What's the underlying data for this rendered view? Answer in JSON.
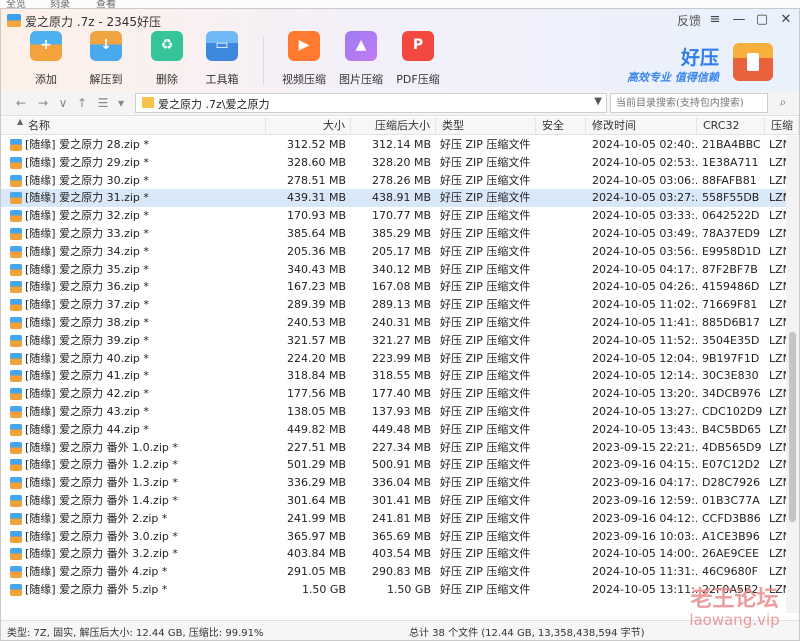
{
  "menubar": {
    "items": [
      "全览",
      "刻录",
      "查看"
    ]
  },
  "window": {
    "title": "爱之原力 .7z - 2345好压",
    "feedback": "反馈",
    "controls": [
      "≡",
      "—",
      "▢",
      "✕"
    ]
  },
  "toolbar": [
    {
      "label": "添加",
      "icon": "add-archive-icon"
    },
    {
      "label": "解压到",
      "icon": "extract-icon"
    },
    {
      "label": "删除",
      "icon": "delete-icon"
    },
    {
      "label": "工具箱",
      "icon": "toolbox-icon"
    },
    {
      "label": "视频压缩",
      "icon": "video-compress-icon"
    },
    {
      "label": "图片压缩",
      "icon": "image-compress-icon"
    },
    {
      "label": "PDF压缩",
      "icon": "pdf-compress-icon"
    }
  ],
  "brand": {
    "name": "好压",
    "slogan": "高效专业  值得信赖"
  },
  "address": {
    "path": "爱之原力 .7z\\爱之原力",
    "search_placeholder": "当前目录搜索(支持包内搜索)"
  },
  "columns": [
    "名称",
    "大小",
    "压缩后大小",
    "类型",
    "安全",
    "修改时间",
    "CRC32",
    "压缩"
  ],
  "files": [
    {
      "name": "[随缘] 爱之原力 28.zip *",
      "size": "312.52 MB",
      "packed": "312.14 MB",
      "type": "好压 ZIP 压缩文件",
      "security": "",
      "modified": "2024-10-05 02:40:...",
      "crc": "21BA4BBC",
      "method": "LZN"
    },
    {
      "name": "[随缘] 爱之原力 29.zip *",
      "size": "328.60 MB",
      "packed": "328.20 MB",
      "type": "好压 ZIP 压缩文件",
      "security": "",
      "modified": "2024-10-05 02:53:...",
      "crc": "1E38A711",
      "method": "LZN"
    },
    {
      "name": "[随缘] 爱之原力 30.zip *",
      "size": "278.51 MB",
      "packed": "278.26 MB",
      "type": "好压 ZIP 压缩文件",
      "security": "",
      "modified": "2024-10-05 03:06:...",
      "crc": "88FAFB81",
      "method": "LZN"
    },
    {
      "name": "[随缘] 爱之原力 31.zip *",
      "size": "439.31 MB",
      "packed": "438.91 MB",
      "type": "好压 ZIP 压缩文件",
      "security": "",
      "modified": "2024-10-05 03:27:...",
      "crc": "558F55DB",
      "method": "LZN"
    },
    {
      "name": "[随缘] 爱之原力 32.zip *",
      "size": "170.93 MB",
      "packed": "170.77 MB",
      "type": "好压 ZIP 压缩文件",
      "security": "",
      "modified": "2024-10-05 03:33:...",
      "crc": "0642522D",
      "method": "LZN"
    },
    {
      "name": "[随缘] 爱之原力 33.zip *",
      "size": "385.64 MB",
      "packed": "385.29 MB",
      "type": "好压 ZIP 压缩文件",
      "security": "",
      "modified": "2024-10-05 03:49:...",
      "crc": "78A37ED9",
      "method": "LZN"
    },
    {
      "name": "[随缘] 爱之原力 34.zip *",
      "size": "205.36 MB",
      "packed": "205.17 MB",
      "type": "好压 ZIP 压缩文件",
      "security": "",
      "modified": "2024-10-05 03:56:...",
      "crc": "E9958D1D",
      "method": "LZN"
    },
    {
      "name": "[随缘] 爱之原力 35.zip *",
      "size": "340.43 MB",
      "packed": "340.12 MB",
      "type": "好压 ZIP 压缩文件",
      "security": "",
      "modified": "2024-10-05 04:17:...",
      "crc": "87F2BF7B",
      "method": "LZN"
    },
    {
      "name": "[随缘] 爱之原力 36.zip *",
      "size": "167.23 MB",
      "packed": "167.08 MB",
      "type": "好压 ZIP 压缩文件",
      "security": "",
      "modified": "2024-10-05 04:26:...",
      "crc": "4159486D",
      "method": "LZN"
    },
    {
      "name": "[随缘] 爱之原力 37.zip *",
      "size": "289.39 MB",
      "packed": "289.13 MB",
      "type": "好压 ZIP 压缩文件",
      "security": "",
      "modified": "2024-10-05 11:02:...",
      "crc": "71669F81",
      "method": "LZN"
    },
    {
      "name": "[随缘] 爱之原力 38.zip *",
      "size": "240.53 MB",
      "packed": "240.31 MB",
      "type": "好压 ZIP 压缩文件",
      "security": "",
      "modified": "2024-10-05 11:41:...",
      "crc": "885D6B17",
      "method": "LZN"
    },
    {
      "name": "[随缘] 爱之原力 39.zip *",
      "size": "321.57 MB",
      "packed": "321.27 MB",
      "type": "好压 ZIP 压缩文件",
      "security": "",
      "modified": "2024-10-05 11:52:...",
      "crc": "3504E35D",
      "method": "LZN"
    },
    {
      "name": "[随缘] 爱之原力 40.zip *",
      "size": "224.20 MB",
      "packed": "223.99 MB",
      "type": "好压 ZIP 压缩文件",
      "security": "",
      "modified": "2024-10-05 12:04:...",
      "crc": "9B197F1D",
      "method": "LZN"
    },
    {
      "name": "[随缘] 爱之原力 41.zip *",
      "size": "318.84 MB",
      "packed": "318.55 MB",
      "type": "好压 ZIP 压缩文件",
      "security": "",
      "modified": "2024-10-05 12:14:...",
      "crc": "30C3E830",
      "method": "LZN"
    },
    {
      "name": "[随缘] 爱之原力 42.zip *",
      "size": "177.56 MB",
      "packed": "177.40 MB",
      "type": "好压 ZIP 压缩文件",
      "security": "",
      "modified": "2024-10-05 13:20:...",
      "crc": "34DCB976",
      "method": "LZN"
    },
    {
      "name": "[随缘] 爱之原力 43.zip *",
      "size": "138.05 MB",
      "packed": "137.93 MB",
      "type": "好压 ZIP 压缩文件",
      "security": "",
      "modified": "2024-10-05 13:27:...",
      "crc": "CDC102D9",
      "method": "LZN"
    },
    {
      "name": "[随缘] 爱之原力 44.zip *",
      "size": "449.82 MB",
      "packed": "449.48 MB",
      "type": "好压 ZIP 压缩文件",
      "security": "",
      "modified": "2024-10-05 13:43:...",
      "crc": "B4C5BD65",
      "method": "LZN"
    },
    {
      "name": "[随缘] 爱之原力 番外 1.0.zip *",
      "size": "227.51 MB",
      "packed": "227.34 MB",
      "type": "好压 ZIP 压缩文件",
      "security": "",
      "modified": "2023-09-15 22:21:...",
      "crc": "4DB565D9",
      "method": "LZN"
    },
    {
      "name": "[随缘] 爱之原力 番外 1.2.zip *",
      "size": "501.29 MB",
      "packed": "500.91 MB",
      "type": "好压 ZIP 压缩文件",
      "security": "",
      "modified": "2023-09-16 04:15:...",
      "crc": "E07C12D2",
      "method": "LZN"
    },
    {
      "name": "[随缘] 爱之原力 番外 1.3.zip *",
      "size": "336.29 MB",
      "packed": "336.04 MB",
      "type": "好压 ZIP 压缩文件",
      "security": "",
      "modified": "2023-09-16 04:17:...",
      "crc": "D28C7926",
      "method": "LZN"
    },
    {
      "name": "[随缘] 爱之原力 番外 1.4.zip *",
      "size": "301.64 MB",
      "packed": "301.41 MB",
      "type": "好压 ZIP 压缩文件",
      "security": "",
      "modified": "2023-09-16 12:59:...",
      "crc": "01B3C77A",
      "method": "LZN"
    },
    {
      "name": "[随缘] 爱之原力 番外 2.zip *",
      "size": "241.99 MB",
      "packed": "241.81 MB",
      "type": "好压 ZIP 压缩文件",
      "security": "",
      "modified": "2023-09-16 04:12:...",
      "crc": "CCFD3B86",
      "method": "LZN"
    },
    {
      "name": "[随缘] 爱之原力 番外 3.0.zip *",
      "size": "365.97 MB",
      "packed": "365.69 MB",
      "type": "好压 ZIP 压缩文件",
      "security": "",
      "modified": "2023-09-16 10:03:...",
      "crc": "A1CE3B96",
      "method": "LZN"
    },
    {
      "name": "[随缘] 爱之原力 番外 3.2.zip *",
      "size": "403.84 MB",
      "packed": "403.54 MB",
      "type": "好压 ZIP 压缩文件",
      "security": "",
      "modified": "2024-10-05 14:00:...",
      "crc": "26AE9CEE",
      "method": "LZN"
    },
    {
      "name": "[随缘] 爱之原力 番外 4.zip *",
      "size": "291.05 MB",
      "packed": "290.83 MB",
      "type": "好压 ZIP 压缩文件",
      "security": "",
      "modified": "2024-10-05 11:31:...",
      "crc": "46C9680F",
      "method": "LZN"
    },
    {
      "name": "[随缘] 爱之原力 番外 5.zip *",
      "size": "1.50 GB",
      "packed": "1.50 GB",
      "type": "好压 ZIP 压缩文件",
      "security": "",
      "modified": "2024-10-05 13:11:...",
      "crc": "22F0A5B2",
      "method": "LZN"
    }
  ],
  "selected_row": 3,
  "status": {
    "left": "类型: 7Z, 固实, 解压后大小: 12.44 GB, 压缩比: 99.91%",
    "right": "总计 38 个文件 (12.44 GB, 13,358,438,594 字节)"
  },
  "watermark": {
    "text": "老王论坛",
    "url": "laowang.vip"
  },
  "colors": {
    "accent": "#2f7de8",
    "selection": "#d9e8f8",
    "watermark": "#e98b8b"
  }
}
